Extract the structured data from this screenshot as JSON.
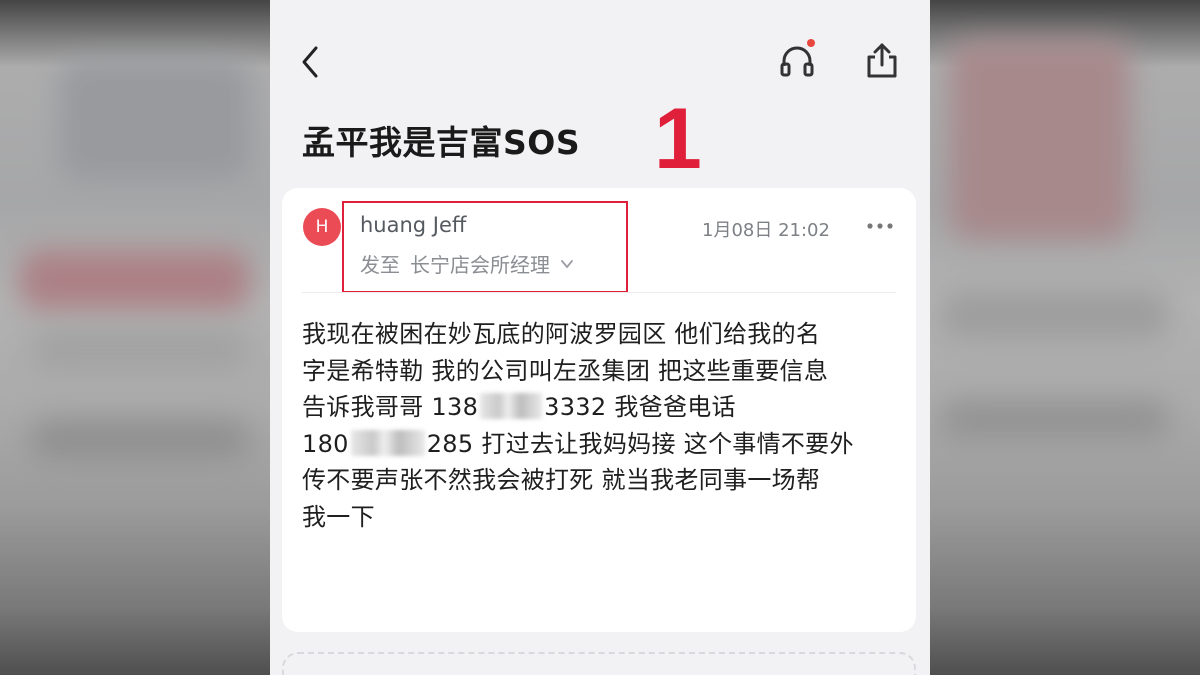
{
  "header": {
    "subject": "孟平我是吉富SOS",
    "annotation_number": "1"
  },
  "email": {
    "avatar_initial": "H",
    "sender_name": "huang Jeff",
    "recipient_prefix": "发至",
    "recipient_name": "长宁店会所经理",
    "timestamp": "1月08日 21:02",
    "body_lines": [
      "我现在被困在妙瓦底的阿波罗园区 他们给我的名",
      "字是希特勒 我的公司叫左丞集团 把这些重要信息",
      "告诉我哥哥 138",
      "3332 我爸爸电话",
      "180",
      "285 打过去让我妈妈接 这个事情不要外",
      "传不要声张不然我会被打死 就当我老同事一场帮",
      "我一下"
    ]
  },
  "icons": {
    "back": "chevron-left-icon",
    "audio": "headphones-icon",
    "share": "share-icon",
    "more": "more-horizontal-icon",
    "expand": "chevron-down-icon"
  },
  "colors": {
    "avatar": "#ea4b55",
    "annotation": "#e0203a",
    "notification_dot": "#e8473d"
  }
}
